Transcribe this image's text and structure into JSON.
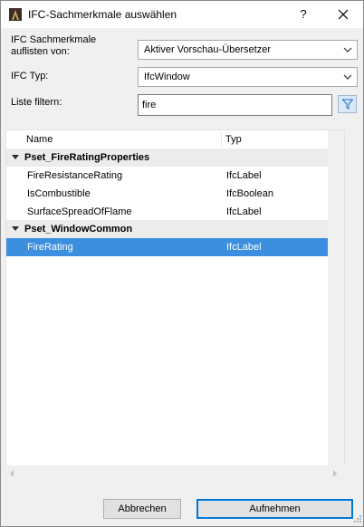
{
  "window": {
    "title": "IFC-Sachmerkmale auswählen",
    "help_label": "?"
  },
  "form": {
    "list_from_label_line1": "IFC Sachmerkmale",
    "list_from_label_line2": "auflisten von:",
    "list_from_value": "Aktiver Vorschau-Übersetzer",
    "ifc_type_label": "IFC Typ:",
    "ifc_type_value": "IfcWindow",
    "filter_label": "Liste filtern:",
    "filter_value": "fire"
  },
  "tree": {
    "columns": {
      "name": "Name",
      "type": "Typ"
    },
    "groups": [
      {
        "name": "Pset_FireRatingProperties",
        "properties": [
          {
            "name": "FireResistanceRating",
            "type": "IfcLabel"
          },
          {
            "name": "IsCombustible",
            "type": "IfcBoolean"
          },
          {
            "name": "SurfaceSpreadOfFlame",
            "type": "IfcLabel"
          }
        ]
      },
      {
        "name": "Pset_WindowCommon",
        "properties": [
          {
            "name": "FireRating",
            "type": "IfcLabel",
            "selected": true
          }
        ]
      }
    ]
  },
  "buttons": {
    "cancel": "Abbrechen",
    "add": "Aufnehmen"
  },
  "colors": {
    "selection": "#3c8fde",
    "group_row": "#ececec",
    "primary_border": "#0078d7"
  }
}
